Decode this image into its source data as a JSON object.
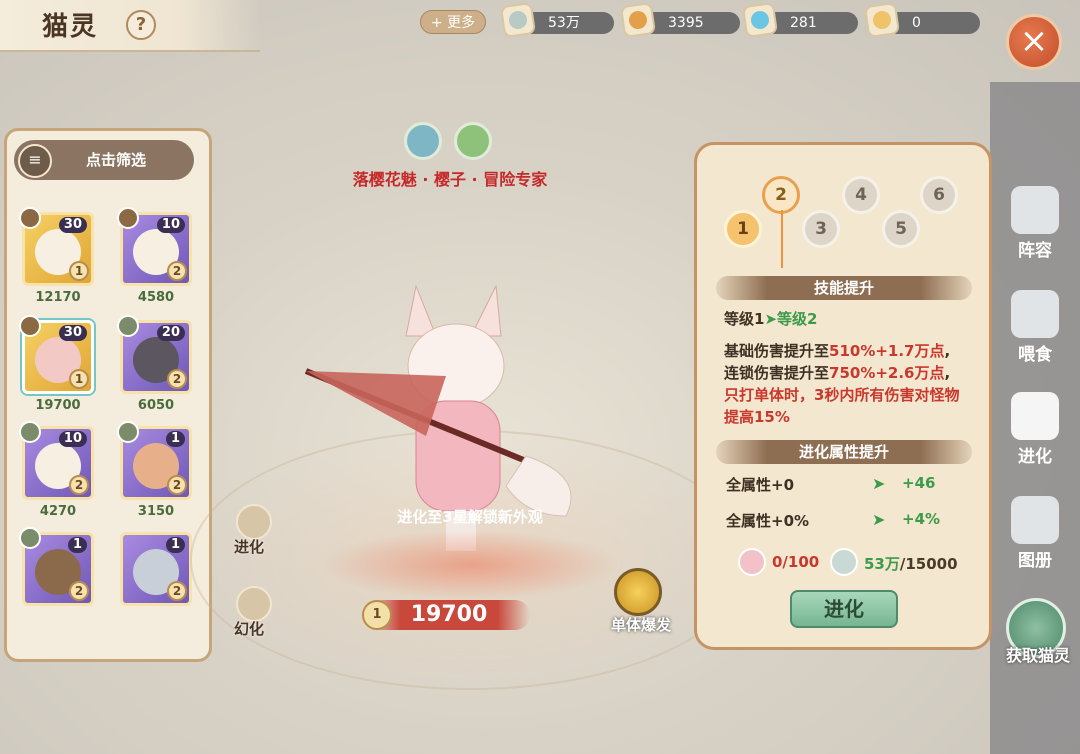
{
  "header": {
    "title": "猫灵",
    "help": "?"
  },
  "resources": {
    "more_label": "+ 更多",
    "items": [
      {
        "value": "53万",
        "icon": "feather-icon",
        "color": "#b9c9c4"
      },
      {
        "value": "3395",
        "icon": "fish-icon",
        "color": "#e3a04a"
      },
      {
        "value": "281",
        "icon": "gem-icon",
        "color": "#6bc6e3"
      },
      {
        "value": "0",
        "icon": "orb-icon",
        "color": "#f0c36a"
      }
    ]
  },
  "close_icon": "×",
  "sidebar": {
    "items": [
      {
        "label": "阵容",
        "icon": "team-icon"
      },
      {
        "label": "喂食",
        "icon": "feed-icon"
      },
      {
        "label": "进化",
        "icon": "paw-icon",
        "active": true
      },
      {
        "label": "图册",
        "icon": "book-icon"
      }
    ],
    "get_cat_label": "获取猫灵"
  },
  "cat_list": {
    "filter_label": "点击筛选",
    "cats": [
      {
        "level": "30",
        "stars": "1",
        "power": "12170",
        "rarity": "gold"
      },
      {
        "level": "10",
        "stars": "2",
        "power": "4580",
        "rarity": "purple"
      },
      {
        "level": "30",
        "stars": "1",
        "power": "19700",
        "rarity": "gold",
        "selected": true
      },
      {
        "level": "20",
        "stars": "2",
        "power": "6050",
        "rarity": "purple"
      },
      {
        "level": "10",
        "stars": "2",
        "power": "4270",
        "rarity": "purple"
      },
      {
        "level": "1",
        "stars": "2",
        "power": "3150",
        "rarity": "purple"
      },
      {
        "level": "1",
        "stars": "2",
        "power": "",
        "rarity": "purple"
      },
      {
        "level": "1",
        "stars": "2",
        "power": "",
        "rarity": "purple"
      }
    ]
  },
  "character": {
    "name_line": "落樱花魅 · 樱子 · 冒险专家",
    "unlock_hint": "进化至3星解锁新外观",
    "power": "19700",
    "star_icon_label": "1",
    "evolve_label": "进化",
    "skin_label": "幻化",
    "skill_label": "单体爆发"
  },
  "detail": {
    "star_nodes": [
      "1",
      "2",
      "3",
      "4",
      "5",
      "6"
    ],
    "skill_title": "技能提升",
    "level_from": "等级1",
    "level_to": "等级2",
    "skill_lines": [
      {
        "prefix": "基础伤害提升至",
        "value": "510%+1.7万点",
        "suffix": ","
      },
      {
        "prefix": "连锁伤害提升至",
        "value": "750%+2.6万点",
        "suffix": ","
      }
    ],
    "skill_extra": "只打单体时，3秒内所有伤害对怪物提高15%",
    "attr_title": "进化属性提升",
    "attrs": [
      {
        "label": "全属性+0",
        "gain": "+46"
      },
      {
        "label": "全属性+0%",
        "gain": "+4%"
      }
    ],
    "cost_shards": "0/100",
    "cost_feather_have": "53万",
    "cost_feather_need": "/15000",
    "evolve_button": "进化"
  }
}
